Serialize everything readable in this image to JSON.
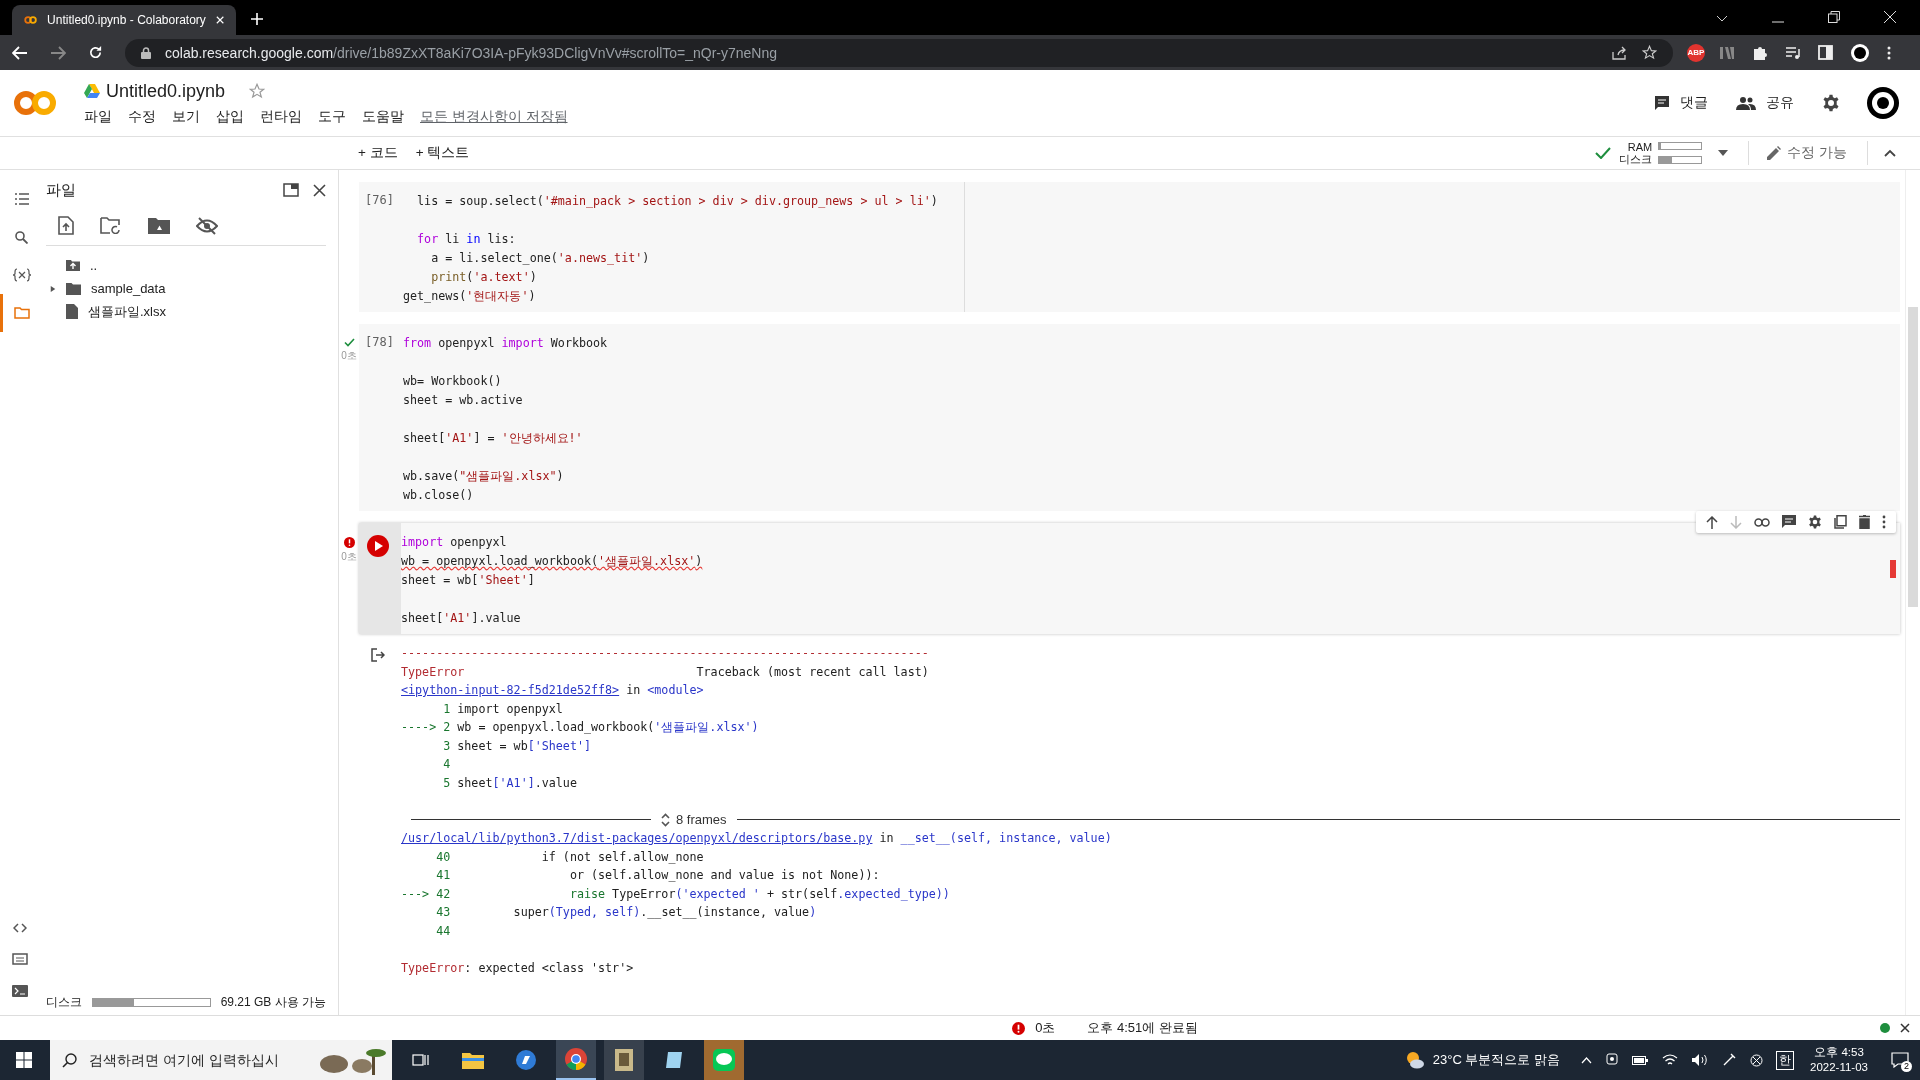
{
  "browser": {
    "tab_title": "Untitled0.ipynb - Colaboratory",
    "url_host": "colab.research.google.com",
    "url_path": "/drive/1b89ZxXT8aKi7O3IA-pFyk93DCligVnVv#scrollTo=_nQr-y7neNng",
    "extension_badge": "ABP"
  },
  "header": {
    "title": "Untitled0.ipynb",
    "menu": [
      "파일",
      "수정",
      "보기",
      "삽입",
      "런타임",
      "도구",
      "도움말"
    ],
    "save_status": "모든 변경사항이 저장됨",
    "comment": "댓글",
    "share": "공유"
  },
  "toolbar": {
    "add_code": "+ 코드",
    "add_text": "+ 텍스트",
    "ram_label": "RAM",
    "disk_label": "디스크",
    "ram": {
      "level": 0.04
    },
    "disk": {
      "level": 0.3
    },
    "edit_mode": "수정 가능"
  },
  "rail": [
    {
      "kind": "toc",
      "selected": false
    },
    {
      "kind": "search",
      "selected": false
    },
    {
      "kind": "variables",
      "selected": false
    },
    {
      "kind": "files",
      "selected": true
    }
  ],
  "sidebar": {
    "title": "파일",
    "tree": [
      {
        "kind": "up",
        "name": ".."
      },
      {
        "kind": "folder",
        "name": "sample_data",
        "expanded": false
      },
      {
        "kind": "file",
        "name": "샘플파일.xlsx"
      }
    ],
    "disk_label": "디스크",
    "disk": {
      "level": 0.35
    },
    "disk_free": "69.21 GB 사용 가능"
  },
  "cells": [
    {
      "kind": "code",
      "count": "[76]",
      "lines": [
        {
          "gap_after": true,
          "spans": [
            {
              "kind": "plain",
              "text": "  lis = soup.select("
            },
            {
              "kind": "string",
              "text": "'#main_pack > section > div > div.group_news > ul > li'"
            },
            {
              "kind": "plain",
              "text": ")"
            }
          ]
        },
        {
          "spans": [
            {
              "kind": "keyword",
              "text": "  for"
            },
            {
              "kind": "plain",
              "text": " li "
            },
            {
              "kind": "operator",
              "text": "in"
            },
            {
              "kind": "plain",
              "text": " lis:"
            }
          ]
        },
        {
          "spans": [
            {
              "kind": "plain",
              "text": "    a = li.select_one("
            },
            {
              "kind": "string",
              "text": "'a.news_tit'"
            },
            {
              "kind": "plain",
              "text": ")"
            }
          ]
        },
        {
          "spans": [
            {
              "kind": "builtin",
              "text": "    print"
            },
            {
              "kind": "plain",
              "text": "("
            },
            {
              "kind": "string",
              "text": "'a.text'"
            },
            {
              "kind": "plain",
              "text": ")"
            }
          ]
        },
        {
          "spans": [
            {
              "kind": "plain",
              "text": "get_news("
            },
            {
              "kind": "string",
              "text": "'현대자동'"
            },
            {
              "kind": "plain",
              "text": ")"
            }
          ]
        }
      ]
    },
    {
      "kind": "code",
      "count": "[78]",
      "failed": false,
      "time": "0초",
      "lines": [
        {
          "gap_after": true,
          "spans": [
            {
              "kind": "keyword",
              "text": "from"
            },
            {
              "kind": "plain",
              "text": " openpyxl "
            },
            {
              "kind": "keyword",
              "text": "import"
            },
            {
              "kind": "plain",
              "text": " Workbook"
            }
          ]
        },
        {
          "spans": [
            {
              "kind": "plain",
              "text": "wb= Workbook()"
            }
          ]
        },
        {
          "gap_after": true,
          "spans": [
            {
              "kind": "plain",
              "text": "sheet = wb.active"
            }
          ]
        },
        {
          "gap_after": true,
          "spans": [
            {
              "kind": "plain",
              "text": "sheet["
            },
            {
              "kind": "string",
              "text": "'A1'"
            },
            {
              "kind": "plain",
              "text": "] = "
            },
            {
              "kind": "string",
              "text": "'안녕하세요!'"
            }
          ]
        },
        {
          "spans": [
            {
              "kind": "plain",
              "text": "wb.save("
            },
            {
              "kind": "string",
              "text": "\"샘플파일.xlsx\""
            },
            {
              "kind": "plain",
              "text": ")"
            }
          ]
        },
        {
          "spans": [
            {
              "kind": "plain",
              "text": "wb.close()"
            }
          ]
        }
      ]
    },
    {
      "kind": "focused",
      "failed": true,
      "time": "0초",
      "lines": [
        {
          "flagged": false,
          "spans": [
            {
              "kind": "keyword",
              "text": "import"
            },
            {
              "kind": "plain",
              "text": " openpyxl"
            }
          ]
        },
        {
          "flagged": true,
          "spans": [
            {
              "kind": "plain",
              "text": "wb = openpyxl.load_workbook("
            },
            {
              "kind": "string",
              "text": "'샘플파일.xlsx'"
            },
            {
              "kind": "plain",
              "text": ")"
            }
          ]
        },
        {
          "flagged": false,
          "gap_after": true,
          "spans": [
            {
              "kind": "plain",
              "text": "sheet = wb["
            },
            {
              "kind": "string",
              "text": "'Sheet'"
            },
            {
              "kind": "plain",
              "text": "]"
            }
          ]
        },
        {
          "flagged": false,
          "spans": [
            {
              "kind": "plain",
              "text": "sheet["
            },
            {
              "kind": "string",
              "text": "'A1'"
            },
            {
              "kind": "plain",
              "text": "].value"
            }
          ]
        }
      ],
      "output": {
        "frames": "8 frames",
        "before": [
          {
            "spans": [
              {
                "kind": "red",
                "text": "---------------------------------------------------------------------------"
              }
            ]
          },
          {
            "spans": [
              {
                "kind": "red",
                "text": "TypeError"
              },
              {
                "kind": "plain",
                "text": "                                 Traceback (most recent call last)"
              }
            ]
          },
          {
            "spans": [
              {
                "kind": "link",
                "text": "<ipython-input-82-f5d21de52ff8>"
              },
              {
                "kind": "plain",
                "text": " in "
              },
              {
                "kind": "blue",
                "text": "<module>"
              }
            ]
          },
          {
            "spans": [
              {
                "kind": "green",
                "text": "      1 "
              },
              {
                "kind": "plain",
                "text": "import openpyxl"
              }
            ]
          },
          {
            "spans": [
              {
                "kind": "green",
                "text": "----> 2 "
              },
              {
                "kind": "plain",
                "text": "wb = openpyxl.load_workbook("
              },
              {
                "kind": "blue",
                "text": "'샘플파일.xlsx')"
              }
            ]
          },
          {
            "spans": [
              {
                "kind": "green",
                "text": "      3 "
              },
              {
                "kind": "plain",
                "text": "sheet = wb"
              },
              {
                "kind": "blue",
                "text": "['Sheet']"
              }
            ]
          },
          {
            "spans": [
              {
                "kind": "green",
                "text": "      4"
              }
            ]
          },
          {
            "gap_after": true,
            "spans": [
              {
                "kind": "green",
                "text": "      5 "
              },
              {
                "kind": "plain",
                "text": "sheet"
              },
              {
                "kind": "blue",
                "text": "['A1']"
              },
              {
                "kind": "plain",
                "text": ".value"
              }
            ]
          }
        ],
        "after": [
          {
            "spans": [
              {
                "kind": "link",
                "text": "/usr/local/lib/python3.7/dist-packages/openpyxl/descriptors/base.py"
              },
              {
                "kind": "plain",
                "text": " in "
              },
              {
                "kind": "blue",
                "text": "__set__(self, instance, value)"
              }
            ]
          },
          {
            "spans": [
              {
                "kind": "green",
                "text": "     40 "
              },
              {
                "kind": "plain",
                "text": "            if (not self.allow_none"
              }
            ]
          },
          {
            "spans": [
              {
                "kind": "green",
                "text": "     41 "
              },
              {
                "kind": "plain",
                "text": "                or (self.allow_none and value is not None)):"
              }
            ]
          },
          {
            "spans": [
              {
                "kind": "green",
                "text": "---> 42                 raise"
              },
              {
                "kind": "plain",
                "text": " TypeError"
              },
              {
                "kind": "blue",
                "text": "('expected '"
              },
              {
                "kind": "plain",
                "text": " + str(self"
              },
              {
                "kind": "blue",
                "text": ".expected_type))"
              }
            ]
          },
          {
            "spans": [
              {
                "kind": "green",
                "text": "     43 "
              },
              {
                "kind": "plain",
                "text": "        super"
              },
              {
                "kind": "blue",
                "text": "(Typed, self)"
              },
              {
                "kind": "plain",
                "text": ".__set__(instance, value"
              },
              {
                "kind": "blue",
                "text": ")"
              }
            ]
          },
          {
            "gap_after": true,
            "spans": [
              {
                "kind": "green",
                "text": "     44"
              }
            ]
          },
          {
            "spans": [
              {
                "kind": "red",
                "text": "TypeError"
              },
              {
                "kind": "plain",
                "text": ": expected <class 'str'>"
              }
            ]
          }
        ]
      }
    }
  ],
  "status_bar": {
    "time": "0초",
    "message": "오후 4:51에 완료됨"
  },
  "taskbar": {
    "search_placeholder": "검색하려면 여기에 입력하십시",
    "weather": "23°C 부분적으로 맑음",
    "ime": "한",
    "time": "오후 4:53",
    "date": "2022-11-03",
    "notifications": "2"
  }
}
